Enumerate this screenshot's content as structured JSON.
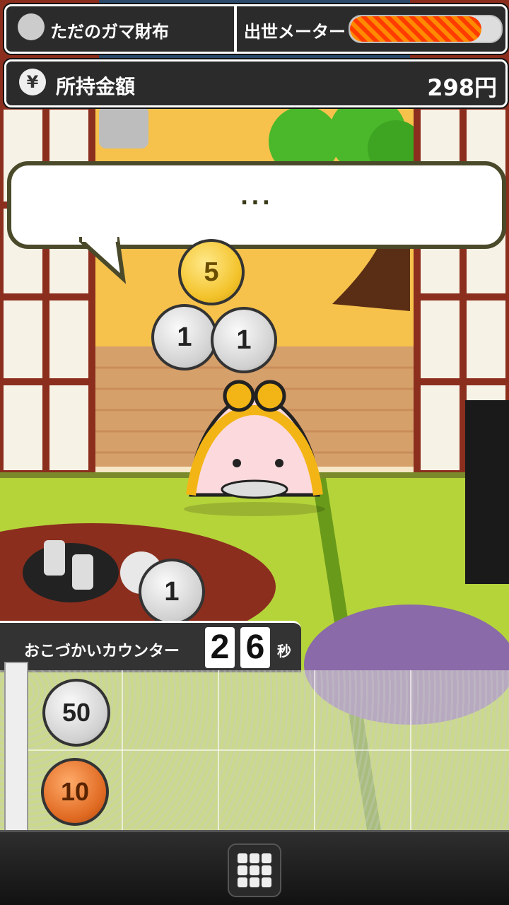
{
  "header": {
    "wallet_name": "ただのガマ財布",
    "meter_label": "出世メーター",
    "meter_progress": 0.87
  },
  "money": {
    "label": "所持金額",
    "value": "298円",
    "yen_symbol": "¥"
  },
  "speech": {
    "text": "..."
  },
  "falling_coins": [
    {
      "value": "5",
      "kind": "gold"
    },
    {
      "value": "1",
      "kind": "silver"
    },
    {
      "value": "1",
      "kind": "silver"
    },
    {
      "value": "1",
      "kind": "silver"
    }
  ],
  "counter": {
    "label": "おこづかいカウンター",
    "digits": [
      "2",
      "6"
    ],
    "unit": "秒"
  },
  "tray_coins": [
    {
      "value": "50",
      "kind": "silver"
    },
    {
      "value": "10",
      "kind": "copper"
    }
  ],
  "colors": {
    "tatami": "#b5d43a",
    "wood": "#8b2e1e",
    "sky": "#f7b840",
    "purse_frame": "#f3b515"
  }
}
